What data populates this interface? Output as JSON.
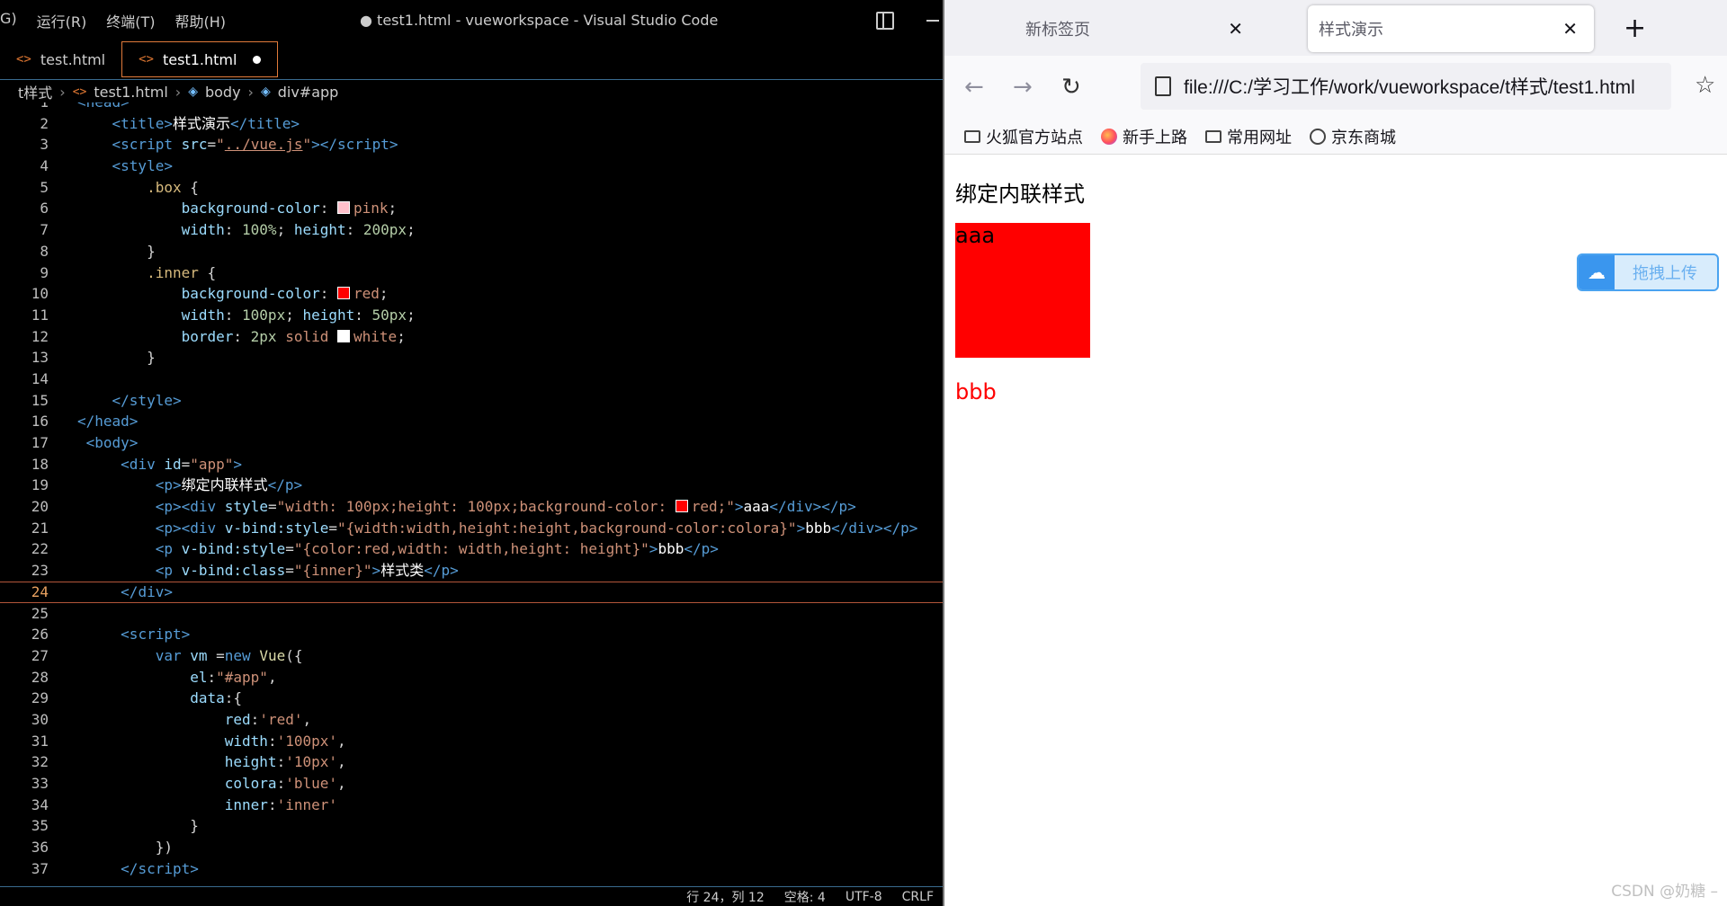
{
  "vscode": {
    "menu": [
      "G)",
      "运行(R)",
      "终端(T)",
      "帮助(H)"
    ],
    "window_title": "● test1.html - vueworkspace - Visual Studio Code",
    "tabs": [
      {
        "label": "test.html",
        "dirty": false
      },
      {
        "label": "test1.html",
        "dirty": true
      }
    ],
    "breadcrumb": [
      "t样式",
      "test1.html",
      "body",
      "div#app"
    ],
    "status": [
      "行 24，列 12",
      "空格: 4",
      "UTF-8",
      "CRLF"
    ],
    "colors": {
      "accent": "#e07a3a",
      "pink": "#ffc0cb",
      "red": "#ff0000",
      "white": "#ffffff"
    }
  },
  "browser": {
    "tabs": [
      {
        "label": "新标签页",
        "active": false
      },
      {
        "label": "样式演示",
        "active": true
      }
    ],
    "url": "file:///C:/学习工作/work/vueworkspace/t样式/test1.html",
    "bookmarks": [
      "火狐官方站点",
      "新手上路",
      "常用网址",
      "京东商城"
    ],
    "page": {
      "heading": "绑定内联样式",
      "box_text": "aaa",
      "bbb_text": "bbb",
      "upload_label": "拖拽上传"
    },
    "watermark": "CSDN @奶糖 –"
  }
}
